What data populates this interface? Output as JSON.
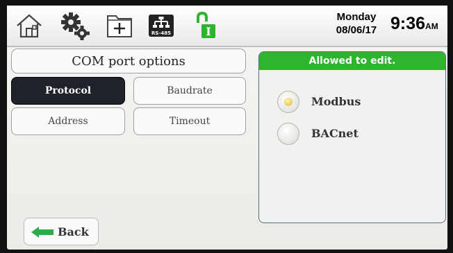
{
  "header": {
    "icons": [
      "home-icon",
      "settings-gears-icon",
      "add-folder-icon",
      "rs485-icon",
      "unlocked-padlock-icon"
    ],
    "rs485_label": "RS-485",
    "lock_letter": "I",
    "day": "Monday",
    "date": "08/06/17",
    "time": "9:36",
    "ampm": "AM"
  },
  "menu": {
    "title": "COM port options",
    "buttons": [
      {
        "label": "Protocol",
        "selected": true
      },
      {
        "label": "Baudrate",
        "selected": false
      },
      {
        "label": "Address",
        "selected": false
      },
      {
        "label": "Timeout",
        "selected": false
      }
    ]
  },
  "panel": {
    "status": "Allowed to edit.",
    "status_color": "#2db52e",
    "options": [
      {
        "label": "Modbus",
        "selected": true
      },
      {
        "label": "BACnet",
        "selected": false
      }
    ]
  },
  "footer": {
    "back_label": "Back",
    "arrow_color": "#2faa48"
  }
}
